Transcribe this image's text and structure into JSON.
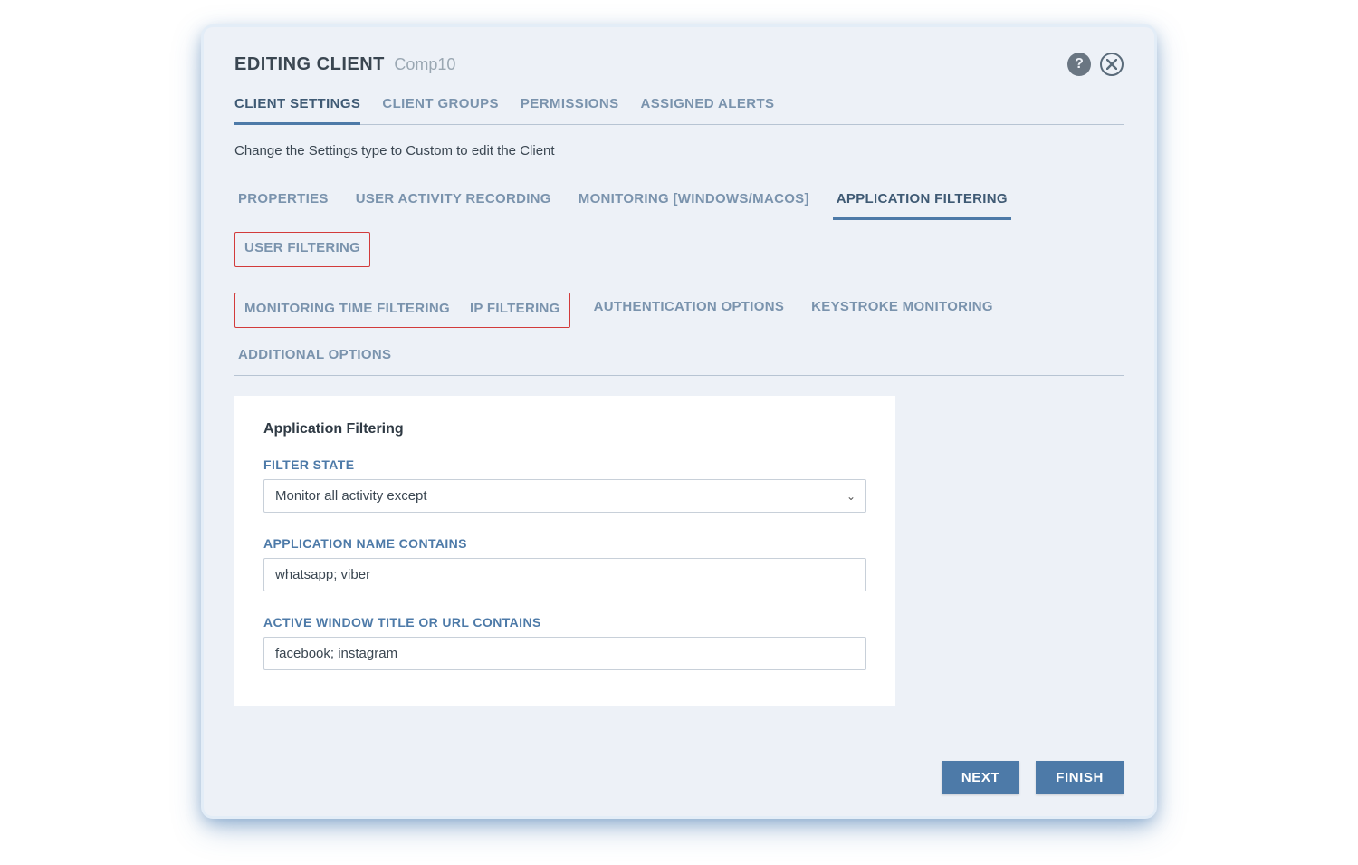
{
  "header": {
    "title": "EDITING CLIENT",
    "subtitle": "Comp10"
  },
  "primary_tabs": [
    {
      "label": "CLIENT SETTINGS",
      "active": true
    },
    {
      "label": "CLIENT GROUPS",
      "active": false
    },
    {
      "label": "PERMISSIONS",
      "active": false
    },
    {
      "label": "ASSIGNED ALERTS",
      "active": false
    }
  ],
  "hint": "Change the Settings type to Custom to edit the Client",
  "sub_tabs_row1": [
    {
      "label": "PROPERTIES"
    },
    {
      "label": "USER ACTIVITY RECORDING"
    },
    {
      "label": "MONITORING [WINDOWS/MACOS]"
    },
    {
      "label": "APPLICATION FILTERING",
      "active": true
    },
    {
      "label": "USER FILTERING",
      "highlight": true
    }
  ],
  "sub_tabs_row2_box": [
    {
      "label": "MONITORING TIME FILTERING"
    },
    {
      "label": "IP FILTERING"
    }
  ],
  "sub_tabs_row2_rest": [
    {
      "label": "AUTHENTICATION OPTIONS"
    },
    {
      "label": "KEYSTROKE MONITORING"
    },
    {
      "label": "ADDITIONAL OPTIONS"
    }
  ],
  "panel": {
    "title": "Application Filtering",
    "filter_state_label": "FILTER STATE",
    "filter_state_value": "Monitor all activity except",
    "app_name_label": "APPLICATION NAME CONTAINS",
    "app_name_value": "whatsapp; viber",
    "window_title_label": "ACTIVE WINDOW TITLE OR URL CONTAINS",
    "window_title_value": "facebook; instagram"
  },
  "footer": {
    "next": "NEXT",
    "finish": "FINISH"
  }
}
